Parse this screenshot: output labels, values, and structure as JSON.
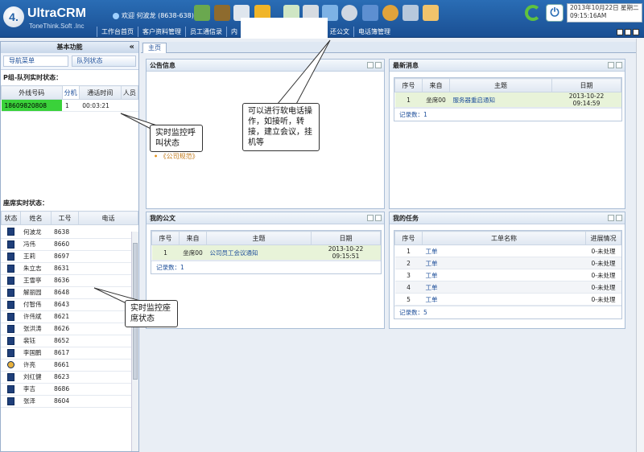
{
  "header": {
    "logo_mark": "4.",
    "logo_title": "UltraCRM",
    "logo_subtitle": "ToneThink.Soft .Inc",
    "welcome": "欢迎 何波龙 (8638-638)",
    "clock_date": "2013年10月22日 星期二",
    "clock_time": "09:15:16AM",
    "power_glyph": "⏻"
  },
  "nav": {
    "items": [
      "工作台首页",
      "客户资料管理",
      "员工通信录",
      "内",
      "还公文",
      "电话簿管理"
    ]
  },
  "left": {
    "title": "基本功能",
    "collapse_glyph": "«",
    "tabs": [
      "导航菜单",
      "队列状态"
    ],
    "queue_title": "P组-队列实时状态：",
    "queue_headers": [
      "外线号码",
      "分机",
      "通话时间",
      "人员"
    ],
    "queue_row": {
      "number": "18609820808",
      "ext": "1",
      "time": "00:03:21",
      "person": ""
    },
    "agent_title": "座席实时状态：",
    "agent_headers": [
      "状态",
      "姓名",
      "工号",
      "电话"
    ],
    "agents": [
      {
        "name": "何波龙",
        "id": "8638"
      },
      {
        "name": "冯伟",
        "id": "8660"
      },
      {
        "name": "王莉",
        "id": "8697"
      },
      {
        "name": "朱立志",
        "id": "8631"
      },
      {
        "name": "王雪亭",
        "id": "8636"
      },
      {
        "name": "解丽园",
        "id": "8648"
      },
      {
        "name": "付智伟",
        "id": "8643"
      },
      {
        "name": "许伟斌",
        "id": "8621"
      },
      {
        "name": "张洪涛",
        "id": "8626"
      },
      {
        "name": "裴钰",
        "id": "8652"
      },
      {
        "name": "李国鹏",
        "id": "8617"
      },
      {
        "name": "许亮",
        "id": "8661"
      },
      {
        "name": "刘红健",
        "id": "8623"
      },
      {
        "name": "李吉",
        "id": "8686"
      },
      {
        "name": "张泽",
        "id": "8604"
      }
    ]
  },
  "main": {
    "home_tab": "主页",
    "announce": {
      "title": "公告信息",
      "item": "《公司规范》"
    },
    "news": {
      "title": "最新消息",
      "headers": [
        "序号",
        "来自",
        "主题",
        "日期"
      ],
      "row": {
        "no": "1",
        "from": "坐席00",
        "subject": "服务器重启通知",
        "date": "2013-10-22 09:14:59"
      },
      "count": "记录数：1"
    },
    "docs": {
      "title": "我的公文",
      "headers": [
        "序号",
        "来自",
        "主题",
        "日期"
      ],
      "row": {
        "no": "1",
        "from": "坐席00",
        "subject": "公司员工会议通知",
        "date": "2013-10-22 09:15:51"
      },
      "count": "记录数：1"
    },
    "tasks": {
      "title": "我的任务",
      "headers": [
        "序号",
        "工单名称",
        "进展情况"
      ],
      "rows": [
        {
          "no": "1",
          "name": "工单",
          "status": "0-未处理"
        },
        {
          "no": "2",
          "name": "工单",
          "status": "0-未处理"
        },
        {
          "no": "3",
          "name": "工单",
          "status": "0-未处理"
        },
        {
          "no": "4",
          "name": "工单",
          "status": "0-未处理"
        },
        {
          "no": "5",
          "name": "工单",
          "status": "0-未处理"
        }
      ],
      "count": "记录数：5"
    }
  },
  "callouts": {
    "call_monitor": "实时监控呼叫状态",
    "phone_ops": "可以进行软电话操作，如接听，转接，建立会议，挂机等",
    "seat_monitor": "实时监控座席状态"
  }
}
